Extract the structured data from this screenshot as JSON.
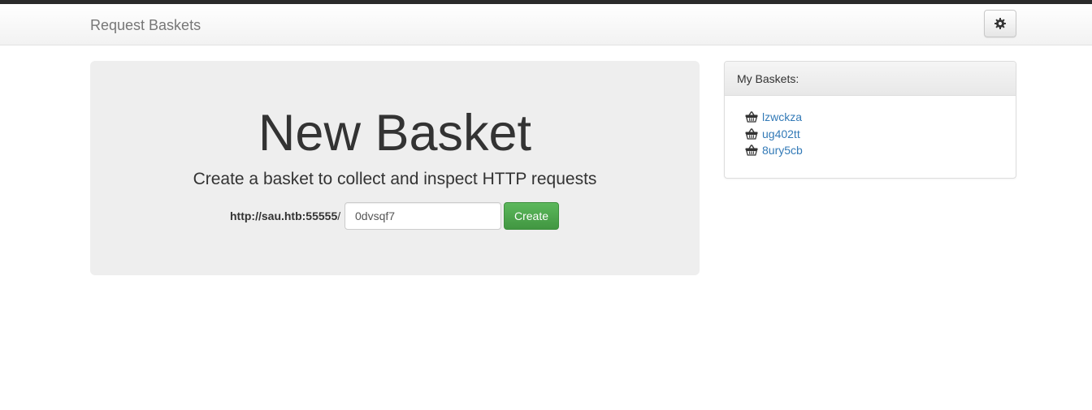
{
  "app": {
    "brand": "Request Baskets",
    "settings_icon": "gear-icon"
  },
  "jumbotron": {
    "title": "New Basket",
    "subtitle": "Create a basket to collect and inspect HTTP requests",
    "url_prefix": "http://sau.htb:55555",
    "url_slash": "/",
    "basket_name_value": "0dvsqf7",
    "create_label": "Create",
    "create_color": "#5cb85c"
  },
  "my_baskets": {
    "heading": "My Baskets:",
    "icon": "basket-icon",
    "link_color": "#337ab7",
    "items": [
      {
        "name": "lzwckza"
      },
      {
        "name": "ug402tt"
      },
      {
        "name": "8ury5cb"
      }
    ]
  }
}
